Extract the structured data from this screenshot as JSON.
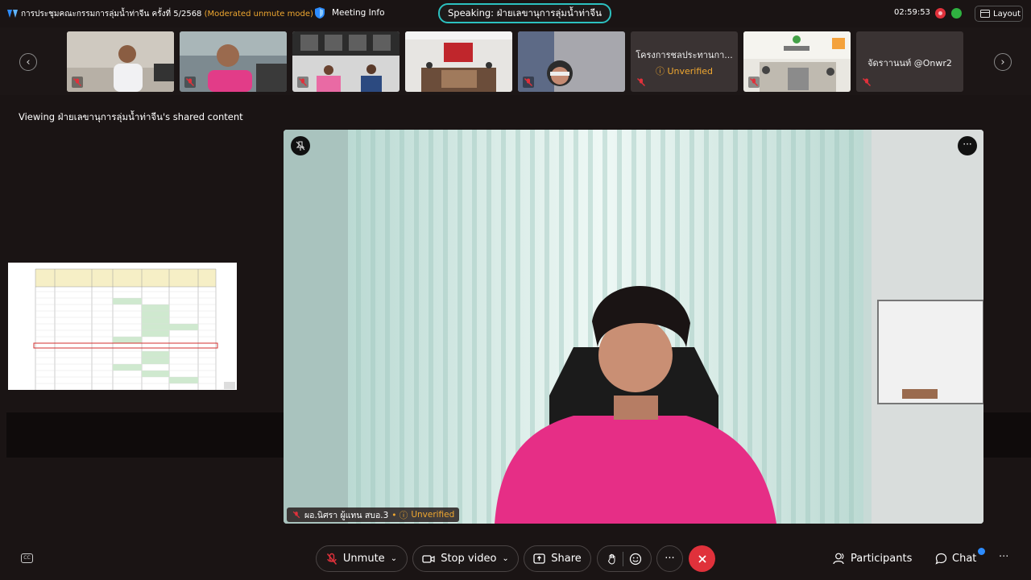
{
  "header": {
    "meeting_title": "การประชุมคณะกรรมการลุ่มน้ำท่าจีน ครั้งที่ 5/2568",
    "mode": "(Moderated unmute mode)",
    "meeting_info": "Meeting Info",
    "speaking": "Speaking: ฝ่ายเลขานุการลุ่มน้ำท่าจีน",
    "timer": "02:59:53",
    "layout_label": "Layout"
  },
  "gallery": {
    "tiles": [
      {
        "type": "video",
        "name": ""
      },
      {
        "type": "video",
        "name": ""
      },
      {
        "type": "video",
        "name": ""
      },
      {
        "type": "video",
        "name": ""
      },
      {
        "type": "video",
        "name": ""
      },
      {
        "type": "name",
        "name": "โครงการชลประทานกา...",
        "status": "Unverified"
      },
      {
        "type": "video",
        "name": ""
      },
      {
        "type": "name",
        "name": "จัดราานนท์ @Onwr2"
      }
    ]
  },
  "viewing_label": "Viewing ฝ่ายเลขานุการลุ่มน้ำท่าจีน's shared content",
  "main_video": {
    "name": "ผอ.นิศรา ผู้แทน สบอ.3",
    "status": "Unverified",
    "more": "···"
  },
  "toolbar": {
    "unmute": "Unmute",
    "stop_video": "Stop video",
    "share": "Share",
    "participants": "Participants",
    "chat": "Chat",
    "more": "···"
  },
  "colors": {
    "background": "#1a1414",
    "accent_teal": "#2cc1c0",
    "warning": "#f0a830",
    "leave_red": "#e0313b",
    "notify_blue": "#2d8cff"
  }
}
